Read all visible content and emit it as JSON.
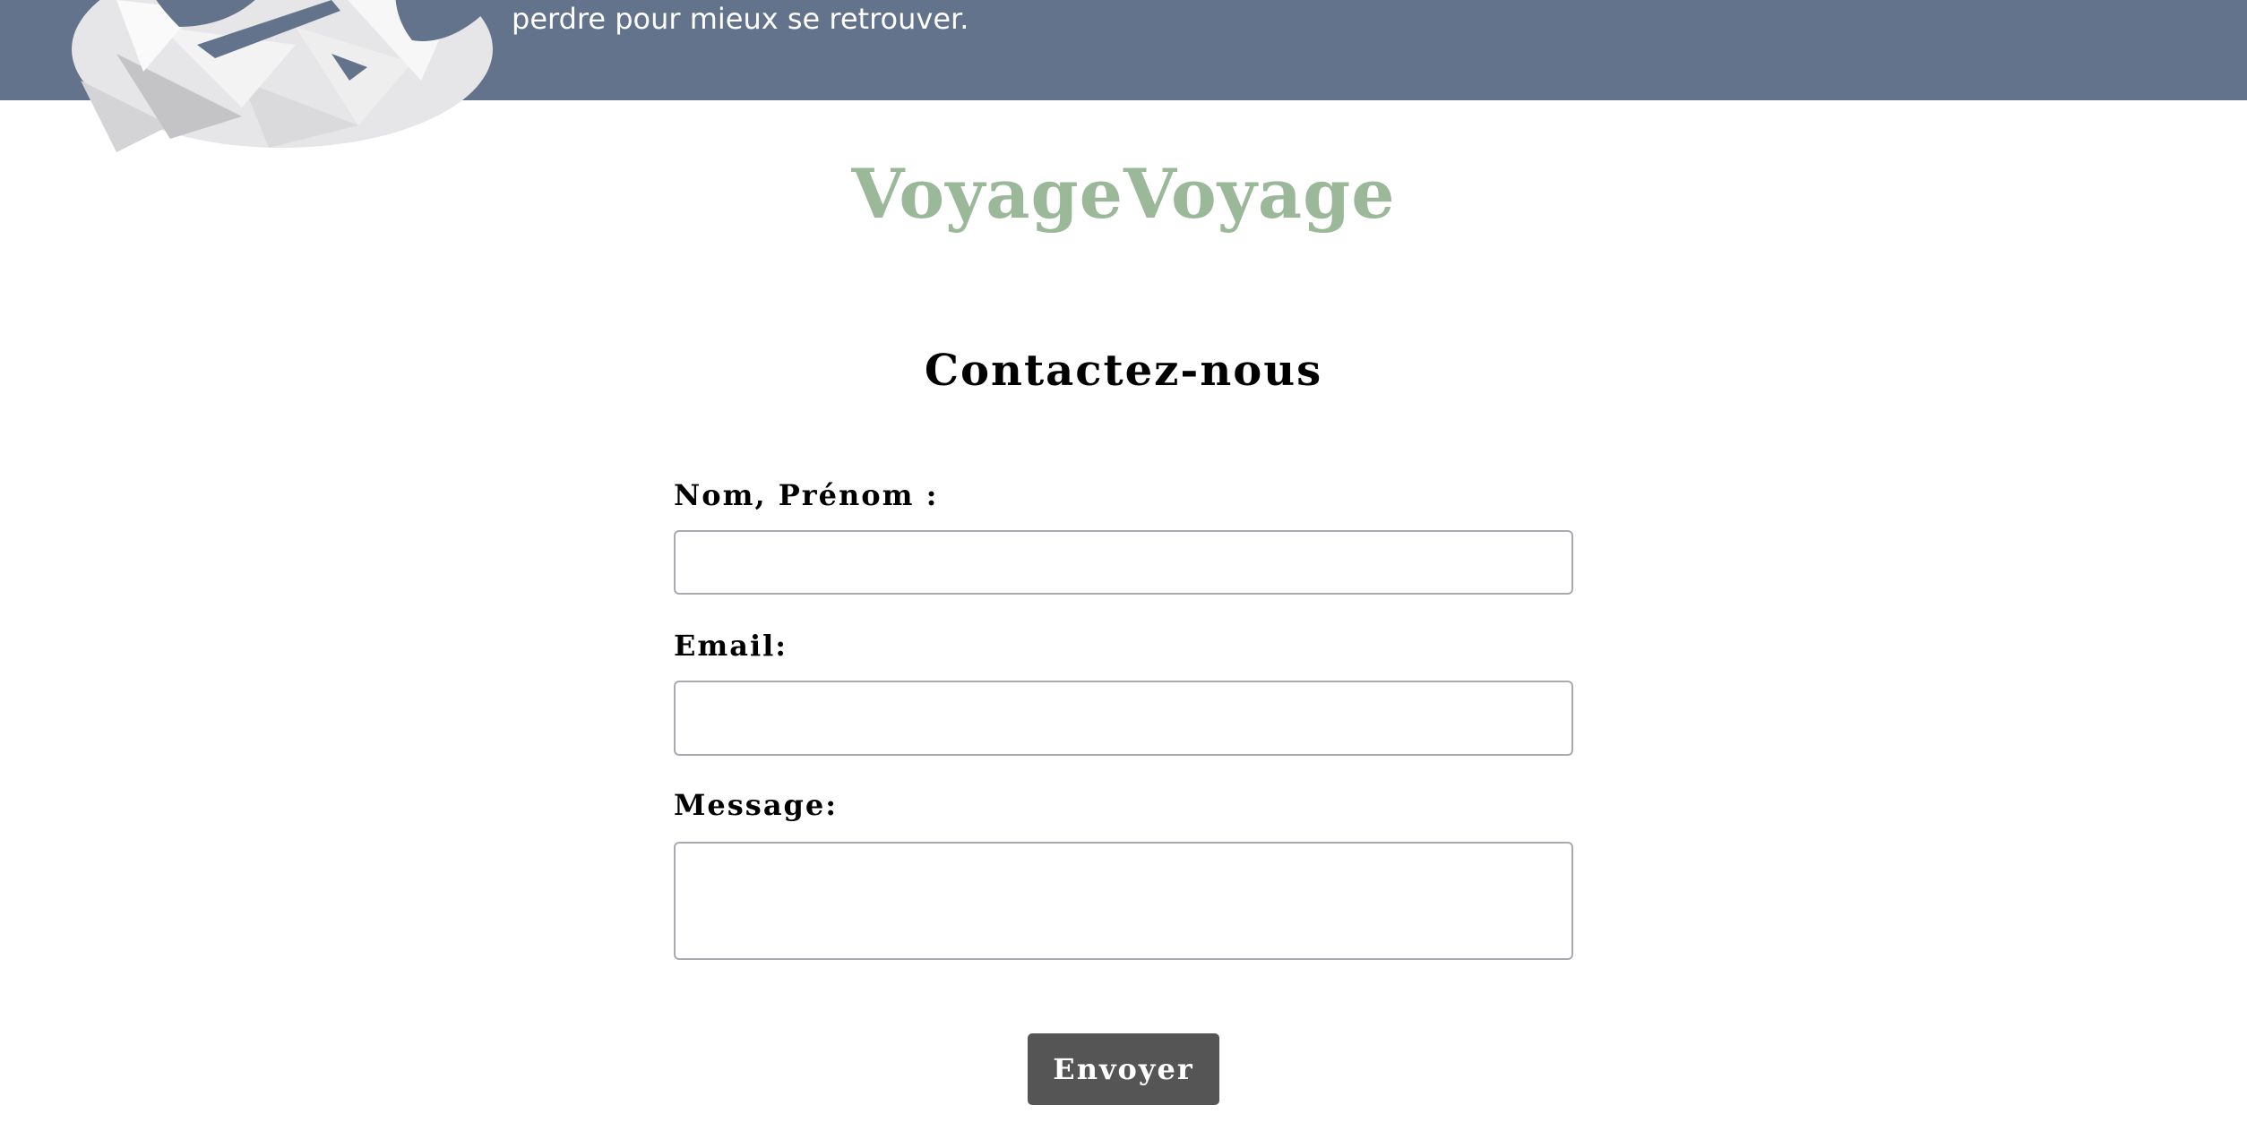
{
  "header": {
    "tagline": "perdre pour mieux se retrouver.",
    "banner_color": "#63738b",
    "logo_icon": "low-poly-globe-icon"
  },
  "brand": {
    "name": "VoyageVoyage",
    "color": "#9bb899"
  },
  "contact": {
    "title": "Contactez-nous",
    "fields": {
      "name_label": "Nom, Prénom :",
      "name_value": "",
      "email_label": "Email:",
      "email_value": "",
      "message_label": "Message:",
      "message_value": ""
    },
    "submit_label": "Envoyer",
    "submit_color": "#555555"
  }
}
